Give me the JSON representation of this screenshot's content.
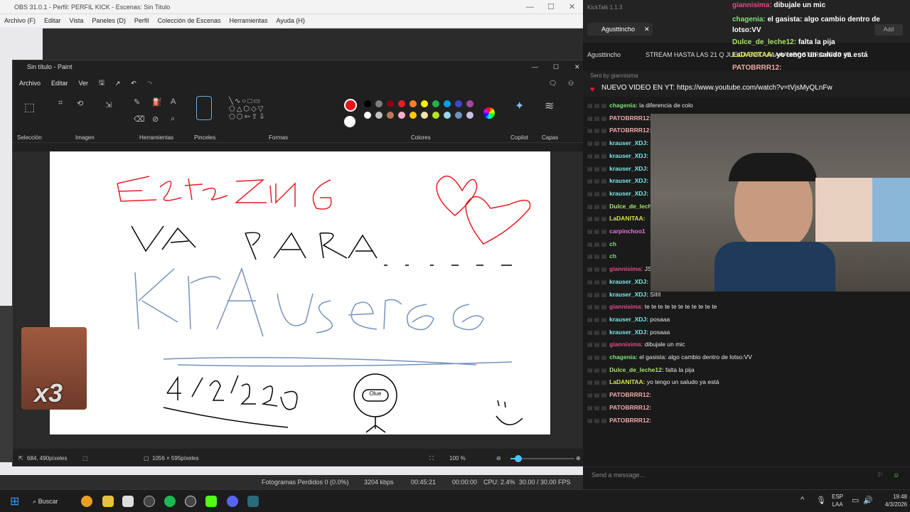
{
  "obs": {
    "title": "OBS 31.0.1 - Perfil: PERFIL KICK - Escenas: Sin Titulo",
    "menu": [
      "Archivo (F)",
      "Editar",
      "Vista",
      "Paneles (D)",
      "Perfil",
      "Colección de Escenas",
      "Herramientas",
      "Ayuda (H)"
    ],
    "status": {
      "dropped": "Fotogramas Perdidos 0 (0.0%)",
      "kbps": "3204 kbps",
      "rec_time": "00:45:21",
      "stream_time": "00:00:00",
      "cpu": "CPU: 2.4%",
      "fps": "30.00 / 30.00 FPS"
    }
  },
  "paint": {
    "title": "Sin título - Paint",
    "menu": [
      "Archivo",
      "Editar",
      "Ver"
    ],
    "groups": {
      "seleccion": "Selección",
      "imagen": "Imagen",
      "herramientas": "Herramientas",
      "pinceles": "Pinceles",
      "formas": "Formas",
      "colores": "Colores",
      "copilot": "Copilot",
      "capas": "Capas"
    },
    "palette_row1": [
      "#000000",
      "#7f7f7f",
      "#880015",
      "#ed1c24",
      "#ff7f27",
      "#fff200",
      "#22b14c",
      "#00a2e8",
      "#3f48cc",
      "#a349a4"
    ],
    "palette_row2": [
      "#ffffff",
      "#c3c3c3",
      "#b97a57",
      "#ffaec9",
      "#ffc90e",
      "#efe4b0",
      "#b5e61d",
      "#99d9ea",
      "#7092be",
      "#c8bfe7"
    ],
    "color1": "#e8141c",
    "color2": "#ffffff",
    "status": {
      "cursor": "684, 490píxeles",
      "size": "1056 × 595píxeles",
      "zoom": "100 %"
    },
    "canvas_text": {
      "line1": "Este zinG",
      "line2": "VA PARA",
      "line3": "KrAuser66",
      "date": "4/3/2026",
      "badge": "Olue"
    }
  },
  "chat": {
    "app_title": "KickTalk 1.1.3",
    "tab_label": "Agusttincho",
    "header_user": "Agusttincho",
    "header_title": "STREAM HASTA LAS 21 Q JUEGA BOKAAAAAA #BOSTERO #FYP #E...",
    "pinned": "NUEVO VIDEO EN YT: https://www.youtube.com/watch?v=tVjsMyQLnFw",
    "pinned_by": "Sent by giannisima",
    "overlay_lines": [
      {
        "user": "giannisima:",
        "text": "dibujale un mic"
      },
      {
        "user": "chagenia:",
        "text": "el gasista: algo cambio dentro de lotso:VV"
      },
      {
        "user": "Dulce_de_leche12:",
        "text": "falta la pija"
      },
      {
        "user": "LaDANITAA:",
        "text": "yo tengo un saludo ya está"
      },
      {
        "user": "PATOBRRR12:",
        "text": ""
      }
    ],
    "add_label": "Add",
    "messages": [
      {
        "user": "chagenia:",
        "text": "la diferencia de colo",
        "color": "#7ce37a"
      },
      {
        "user": "PATOBRRR12:",
        "text": "",
        "color": "#f0a8a8"
      },
      {
        "user": "PATOBRRR12:",
        "text": "",
        "color": "#f0a8a8"
      },
      {
        "user": "krauser_XDJ:",
        "text": "",
        "color": "#7ee6e6"
      },
      {
        "user": "krauser_XDJ:",
        "text": "",
        "color": "#7ee6e6"
      },
      {
        "user": "krauser_XDJ:",
        "text": "",
        "color": "#7ee6e6"
      },
      {
        "user": "krauser_XDJ:",
        "text": "",
        "color": "#7ee6e6"
      },
      {
        "user": "krauser_XDJ:",
        "text": "",
        "color": "#7ee6e6"
      },
      {
        "user": "Dulce_de_leche12:",
        "text": "",
        "color": "#a8e26a"
      },
      {
        "user": "LaDANITAA:",
        "text": "",
        "color": "#d6e24a"
      },
      {
        "user": "carpinchoo1",
        "text": "",
        "color": "#e27ad6"
      },
      {
        "user": "ch",
        "text": "",
        "color": "#7ce37a"
      },
      {
        "user": "ch",
        "text": "",
        "color": "#7ce37a"
      },
      {
        "user": "giannisima:",
        "text": "JSJSKJSJSJ",
        "color": "#e24a8a"
      },
      {
        "user": "krauser_XDJ:",
        "text": "SIIII",
        "color": "#7ee6e6"
      },
      {
        "user": "krauser_XDJ:",
        "text": "SIIII",
        "color": "#7ee6e6"
      },
      {
        "user": "giannisima:",
        "text": "te te te te te te te te te te te",
        "color": "#e24a8a"
      },
      {
        "user": "krauser_XDJ:",
        "text": "posaaa",
        "color": "#7ee6e6"
      },
      {
        "user": "krauser_XDJ:",
        "text": "posaaa",
        "color": "#7ee6e6"
      },
      {
        "user": "giannisima:",
        "text": "dibujale un mic",
        "color": "#e24a8a"
      },
      {
        "user": "chagenia:",
        "text": "el gasista: algo cambio dentro de lotso:VV",
        "color": "#7ce37a"
      },
      {
        "user": "Dulce_de_leche12:",
        "text": "falta la pija",
        "color": "#a8e26a"
      },
      {
        "user": "LaDANITAA:",
        "text": "yo tengo un saludo ya está",
        "color": "#d6e24a"
      },
      {
        "user": "PATOBRRR12:",
        "text": "",
        "color": "#f0a8a8"
      },
      {
        "user": "PATOBRRR12:",
        "text": "",
        "color": "#f0a8a8"
      },
      {
        "user": "PATOBRRR12:",
        "text": "",
        "color": "#f0a8a8"
      }
    ],
    "input_placeholder": "Send a message..."
  },
  "overlay": {
    "multiplier": "x3"
  },
  "taskbar": {
    "search": "Buscar",
    "lang1": "ESP",
    "lang2": "LAA",
    "time": "19:48",
    "date": "4/3/2026"
  }
}
